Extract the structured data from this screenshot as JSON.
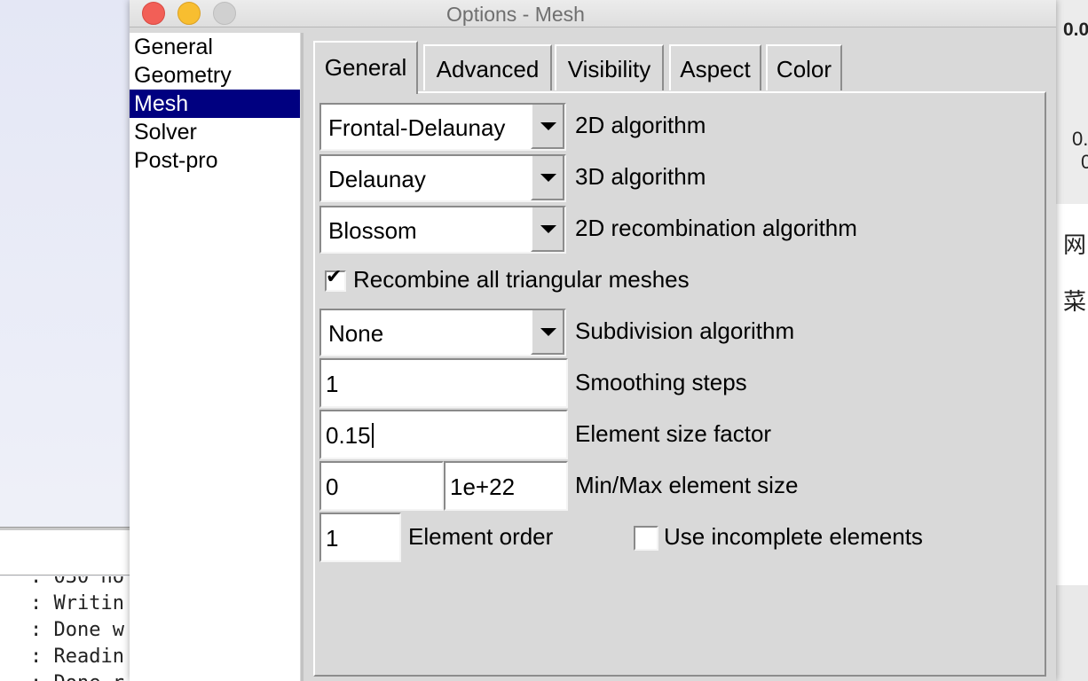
{
  "background": {
    "console_lines": [
      ": 030 no",
      ": Writin",
      ": Done w",
      ": Readin",
      ": Done r"
    ],
    "right_texts": [
      "0.0",
      "0.",
      "0",
      "网",
      "菜"
    ]
  },
  "window": {
    "title": "Options - Mesh",
    "controls": {
      "close": "close",
      "minimize": "minimize",
      "maximize": "maximize"
    }
  },
  "sidebar": {
    "items": [
      {
        "label": "General"
      },
      {
        "label": "Geometry"
      },
      {
        "label": "Mesh",
        "selected": true
      },
      {
        "label": "Solver"
      },
      {
        "label": "Post-pro"
      }
    ]
  },
  "tabs": [
    {
      "label": "General",
      "active": true
    },
    {
      "label": "Advanced"
    },
    {
      "label": "Visibility"
    },
    {
      "label": "Aspect"
    },
    {
      "label": "Color"
    }
  ],
  "general": {
    "algorithm_2d": {
      "value": "Frontal-Delaunay",
      "label": "2D algorithm"
    },
    "algorithm_3d": {
      "value": "Delaunay",
      "label": "3D algorithm"
    },
    "recombination_2d": {
      "value": "Blossom",
      "label": "2D recombination algorithm"
    },
    "recombine_all": {
      "label": "Recombine all triangular meshes",
      "checked": true
    },
    "subdivision": {
      "value": "None",
      "label": "Subdivision algorithm"
    },
    "smoothing_steps": {
      "value": "1",
      "label": "Smoothing steps"
    },
    "element_size_factor": {
      "value": "0.15",
      "label": "Element size factor"
    },
    "min_max_size": {
      "min": "0",
      "max": "1e+22",
      "label": "Min/Max element size"
    },
    "element_order": {
      "value": "1",
      "label": "Element order"
    },
    "incomplete_elements": {
      "label": "Use incomplete elements",
      "checked": false
    }
  },
  "colors": {
    "selection": "#000080",
    "close": "#f25f57",
    "minimize": "#f8be30",
    "maximize_disabled": "#d0d0d0"
  }
}
